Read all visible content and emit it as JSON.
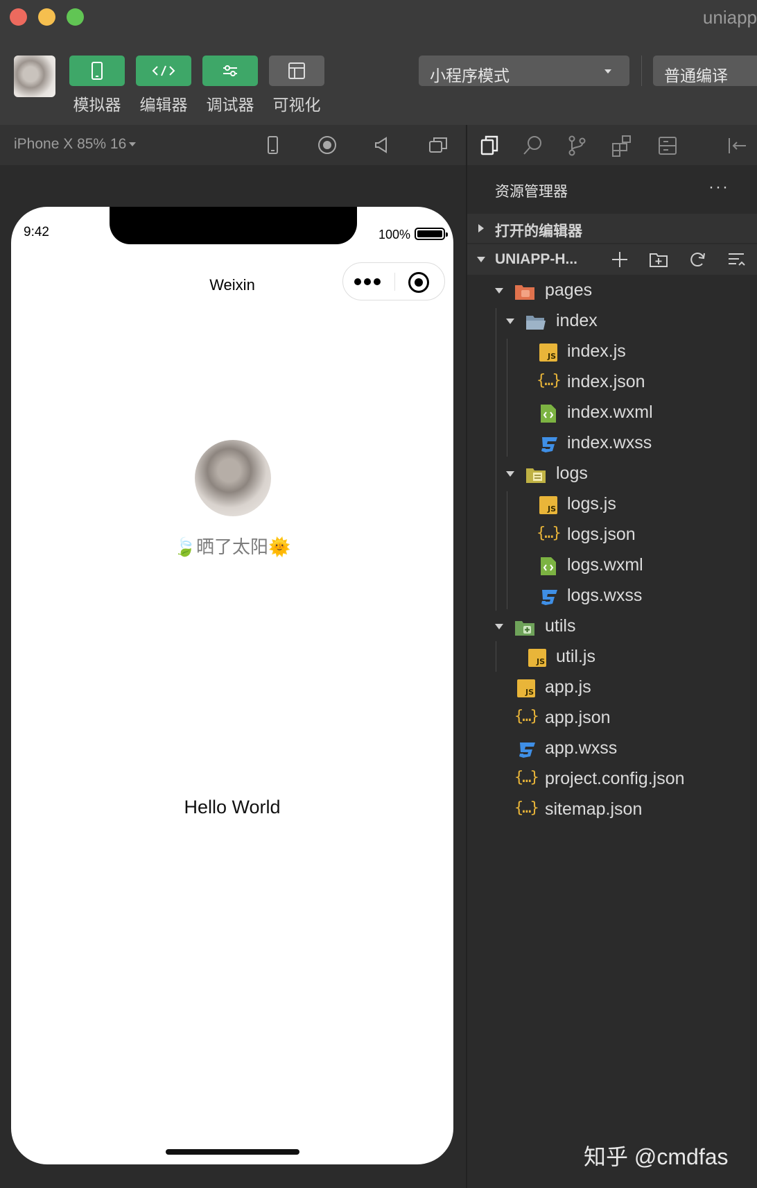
{
  "window": {
    "title": "uniapp"
  },
  "toolbar": {
    "simulator_label": "模拟器",
    "editor_label": "编辑器",
    "debugger_label": "调试器",
    "visual_label": "可视化",
    "mode_value": "小程序模式",
    "compile_value": "普通编译"
  },
  "simulator": {
    "device_value": "iPhone X 85% 16"
  },
  "phone": {
    "time": "9:42",
    "battery": "100%",
    "nav_title": "Weixin",
    "nickname": "🍃晒了太阳🌞",
    "body_text": "Hello World"
  },
  "explorer": {
    "title": "资源管理器",
    "more": "···",
    "open_editors": "打开的编辑器",
    "project_name": "UNIAPP-H...",
    "tree": [
      {
        "name": "pages",
        "type": "folder-pages"
      },
      {
        "name": "index",
        "type": "folder"
      },
      {
        "name": "index.js",
        "type": "js"
      },
      {
        "name": "index.json",
        "type": "json"
      },
      {
        "name": "index.wxml",
        "type": "wxml"
      },
      {
        "name": "index.wxss",
        "type": "wxss"
      },
      {
        "name": "logs",
        "type": "folder-logs"
      },
      {
        "name": "logs.js",
        "type": "js"
      },
      {
        "name": "logs.json",
        "type": "json"
      },
      {
        "name": "logs.wxml",
        "type": "wxml"
      },
      {
        "name": "logs.wxss",
        "type": "wxss"
      },
      {
        "name": "utils",
        "type": "folder-utils"
      },
      {
        "name": "util.js",
        "type": "js"
      },
      {
        "name": "app.js",
        "type": "js"
      },
      {
        "name": "app.json",
        "type": "json"
      },
      {
        "name": "app.wxss",
        "type": "wxss"
      },
      {
        "name": "project.config.json",
        "type": "json"
      },
      {
        "name": "sitemap.json",
        "type": "json"
      }
    ]
  },
  "watermark": "知乎 @cmdfas",
  "colors": {
    "accent_green": "#3ea768",
    "js_yellow": "#e9b539",
    "wxss_blue": "#3f8fe6",
    "wxml_green": "#7cb342"
  }
}
